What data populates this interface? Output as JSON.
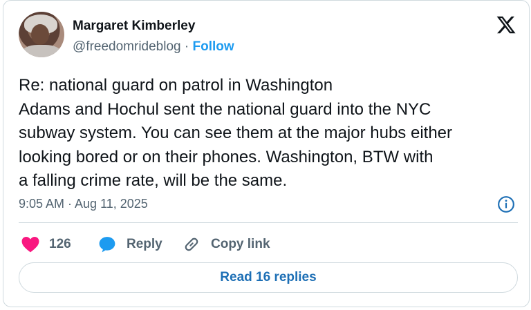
{
  "author": {
    "name": "Margaret Kimberley",
    "handle": "@freedomrideblog",
    "separator": "·",
    "follow_label": "Follow"
  },
  "tweet": {
    "lines": [
      "Re: national guard on patrol in Washington",
      "Adams and Hochul sent the national guard into the NYC",
      "subway system. You can see them at the major hubs either",
      "looking bored or on their phones. Washington, BTW with",
      "a falling crime rate, will be the same."
    ],
    "timestamp": "9:05 AM · Aug 11, 2025"
  },
  "actions": {
    "like_count": "126",
    "reply_label": "Reply",
    "copy_label": "Copy link"
  },
  "footer": {
    "read_replies_label": "Read 16 replies"
  },
  "icons": {
    "logo": "x-logo-icon",
    "info": "info-icon",
    "like": "heart-icon",
    "reply": "speech-bubble-icon",
    "copy": "link-icon"
  },
  "colors": {
    "accent": "#1d9bf0",
    "like": "#f91880",
    "muted": "#536471",
    "border": "#cfd9de"
  }
}
